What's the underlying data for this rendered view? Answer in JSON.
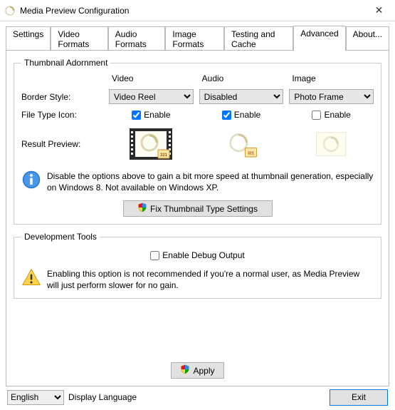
{
  "window": {
    "title": "Media Preview Configuration",
    "close_symbol": "✕"
  },
  "tabs": {
    "items": [
      {
        "label": "Settings"
      },
      {
        "label": "Video Formats"
      },
      {
        "label": "Audio Formats"
      },
      {
        "label": "Image Formats"
      },
      {
        "label": "Testing and Cache"
      },
      {
        "label": "Advanced",
        "active": true
      },
      {
        "label": "About..."
      }
    ]
  },
  "adornment": {
    "legend": "Thumbnail Adornment",
    "columns": {
      "video": "Video",
      "audio": "Audio",
      "image": "Image"
    },
    "row_border": "Border Style:",
    "row_icon": "File Type Icon:",
    "row_preview": "Result Preview:",
    "video_border": "Video Reel",
    "audio_border": "Disabled",
    "image_border": "Photo Frame",
    "enable_label": "Enable",
    "info_text": "Disable the options above to gain a bit more speed at thumbnail generation, especially on Windows 8. Not available on Windows XP.",
    "fix_button": "Fix Thumbnail Type Settings"
  },
  "devtools": {
    "legend": "Development Tools",
    "debug_label": "Enable Debug Output",
    "warning_text": "Enabling this option is not recommended if you're a normal user, as Media Preview will just perform slower for no gain."
  },
  "apply_label": "Apply",
  "footer": {
    "language_value": "English",
    "language_label": "Display Language",
    "exit_label": "Exit"
  }
}
